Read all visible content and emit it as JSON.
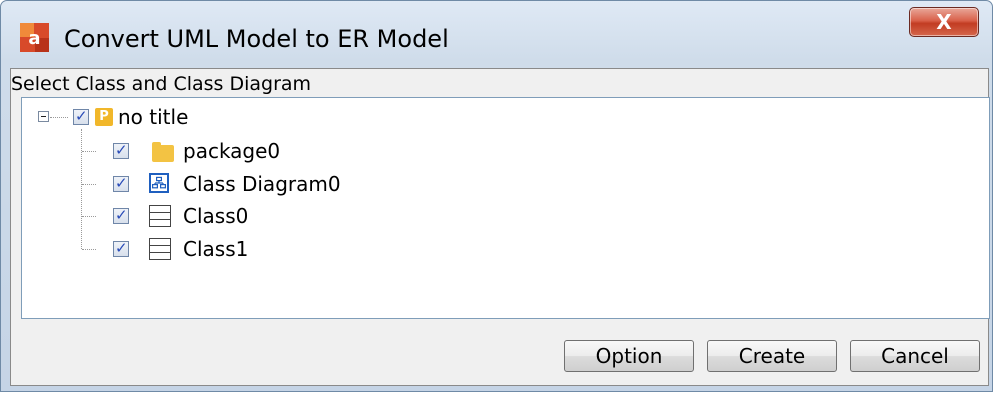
{
  "window": {
    "title": "Convert UML Model to ER Model",
    "app_icon": "astah-app-icon",
    "close_glyph": "X"
  },
  "panel": {
    "label": "Select Class and Class Diagram"
  },
  "tree": {
    "root": {
      "label": "no title",
      "checked": true,
      "icon": "project-icon",
      "icon_letter": "P"
    },
    "children": [
      {
        "label": "package0",
        "checked": true,
        "icon": "folder-icon"
      },
      {
        "label": "Class Diagram0",
        "checked": true,
        "icon": "class-diagram-icon"
      },
      {
        "label": "Class0",
        "checked": true,
        "icon": "class-icon"
      },
      {
        "label": "Class1",
        "checked": true,
        "icon": "class-icon"
      }
    ]
  },
  "buttons": {
    "option": "Option",
    "create": "Create",
    "cancel": "Cancel"
  },
  "colors": {
    "diagram_icon": "#1f5fbf",
    "checkmark": "#2a4cb8",
    "close_button": "#c23c22"
  }
}
